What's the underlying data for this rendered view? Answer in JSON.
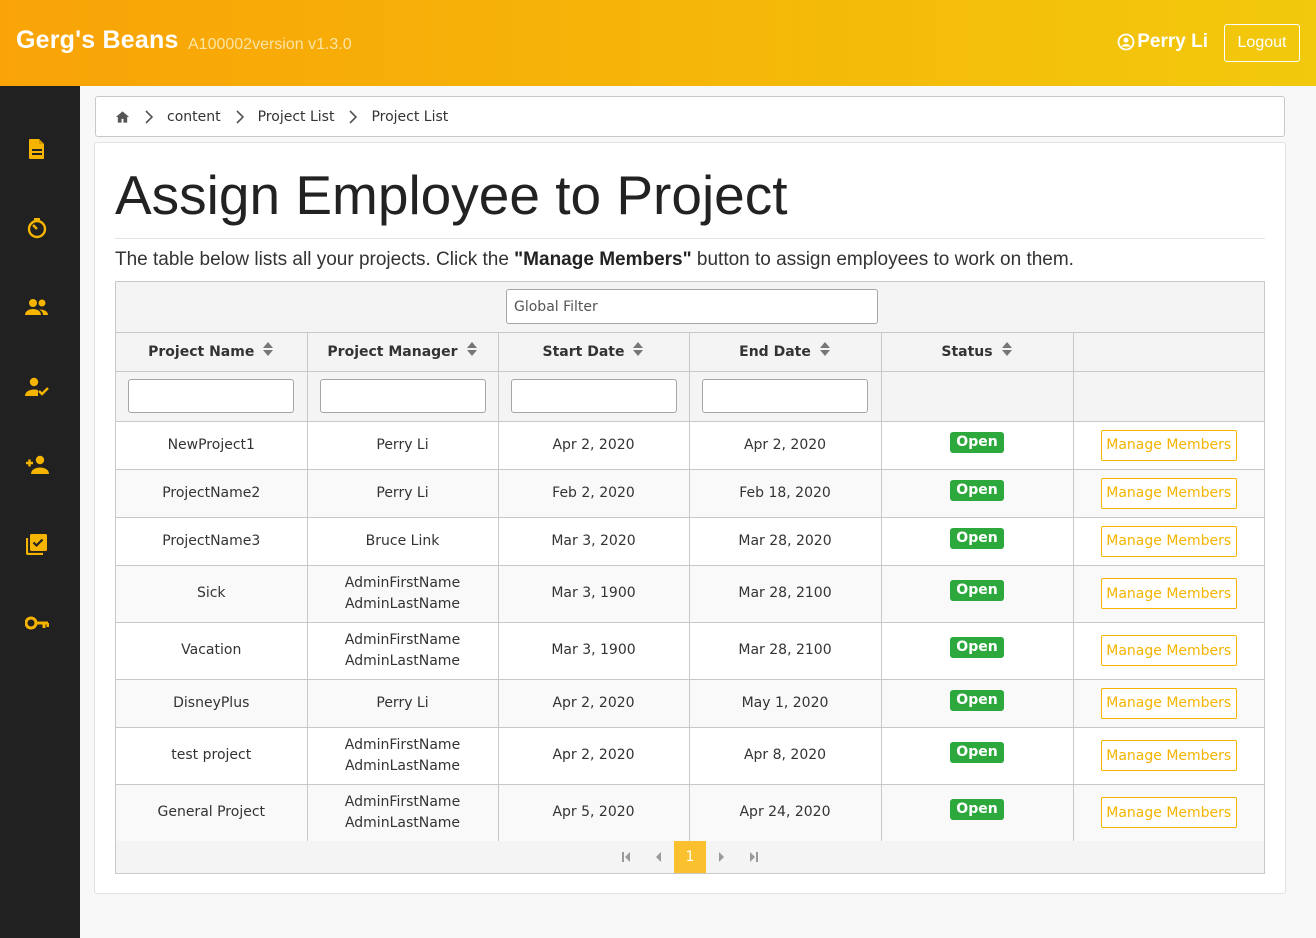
{
  "header": {
    "brand": "Gerg's Beans",
    "version": "A100002version v1.3.0",
    "user_name": "Perry Li",
    "logout_label": "Logout"
  },
  "sidebar": {
    "icons": [
      "document-icon",
      "timer-icon",
      "people-icon",
      "person-check-icon",
      "person-add-icon",
      "checkbox-icon",
      "key-icon"
    ],
    "icon_color": "#f5b400",
    "background": "#212121"
  },
  "breadcrumb": {
    "home_icon": "home-icon",
    "items": [
      "content",
      "Project List",
      "Project List"
    ]
  },
  "page": {
    "title": "Assign Employee to Project",
    "intro_before": "The table below lists all your projects. Click the ",
    "intro_bold": "\"Manage Members\"",
    "intro_after": " button to assign employees to work on them."
  },
  "table": {
    "global_filter_placeholder": "Global Filter",
    "columns": [
      "Project Name",
      "Project Manager",
      "Start Date",
      "End Date",
      "Status",
      ""
    ],
    "status_color": "#2ca83c",
    "action_label": "Manage Members",
    "rows": [
      {
        "name": "NewProject1",
        "manager": "Perry Li",
        "start": "Apr 2, 2020",
        "end": "Apr 2, 2020",
        "status": "Open"
      },
      {
        "name": "ProjectName2",
        "manager": "Perry Li",
        "start": "Feb 2, 2020",
        "end": "Feb 18, 2020",
        "status": "Open"
      },
      {
        "name": "ProjectName3",
        "manager": "Bruce Link",
        "start": "Mar 3, 2020",
        "end": "Mar 28, 2020",
        "status": "Open"
      },
      {
        "name": "Sick",
        "manager": "AdminFirstName AdminLastName",
        "start": "Mar 3, 1900",
        "end": "Mar 28, 2100",
        "status": "Open"
      },
      {
        "name": "Vacation",
        "manager": "AdminFirstName AdminLastName",
        "start": "Mar 3, 1900",
        "end": "Mar 28, 2100",
        "status": "Open"
      },
      {
        "name": "DisneyPlus",
        "manager": "Perry Li",
        "start": "Apr 2, 2020",
        "end": "May 1, 2020",
        "status": "Open"
      },
      {
        "name": "test project",
        "manager": "AdminFirstName AdminLastName",
        "start": "Apr 2, 2020",
        "end": "Apr 8, 2020",
        "status": "Open"
      },
      {
        "name": "General Project",
        "manager": "AdminFirstName AdminLastName",
        "start": "Apr 5, 2020",
        "end": "Apr 24, 2020",
        "status": "Open"
      }
    ]
  },
  "paginator": {
    "current_page": "1",
    "accent": "#fbc02d"
  }
}
